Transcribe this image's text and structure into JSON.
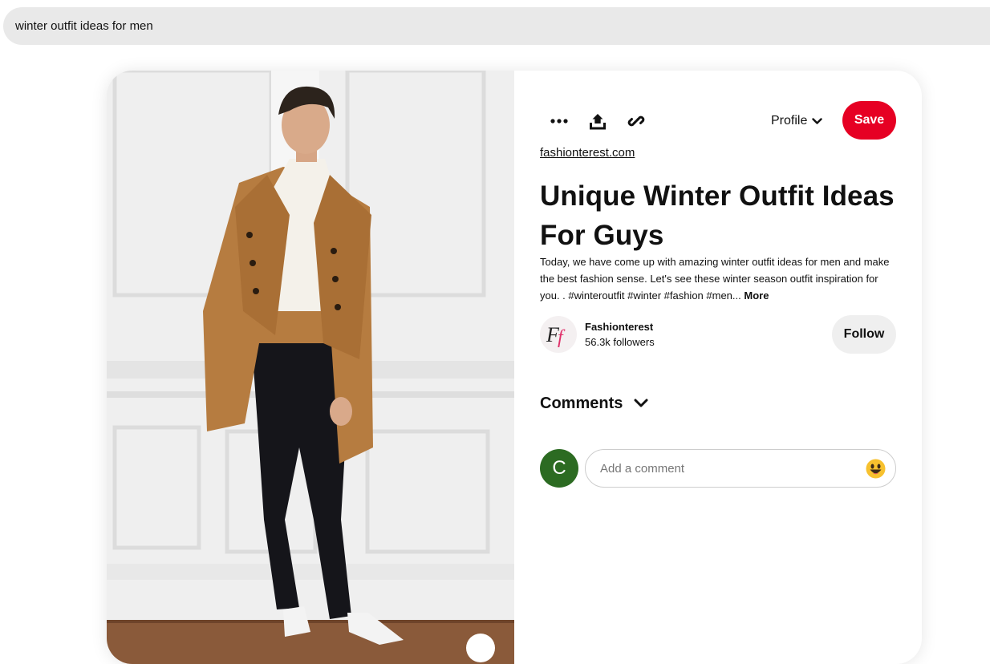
{
  "search": {
    "query": "winter outfit ideas for men"
  },
  "pin": {
    "toolbar": {
      "more_icon": "ellipsis-icon",
      "share_icon": "share-upload-icon",
      "link_icon": "link-icon",
      "profile_label": "Profile",
      "save_label": "Save"
    },
    "source": "fashionterest.com",
    "title": "Unique Winter Outfit Ideas For Guys",
    "description": "Today, we have come up with amazing winter outfit ideas for men and make the best fashion sense. Let's see these winter season outfit inspiration for you. . #winteroutfit #winter #fashion #men...",
    "more_label": "More",
    "creator": {
      "name": "Fashionterest",
      "followers": "56.3k followers",
      "avatar_text": "Ff",
      "follow_label": "Follow"
    },
    "comments": {
      "title": "Comments",
      "user_initial": "C",
      "placeholder": "Add a comment"
    }
  },
  "colors": {
    "save": "#e60023",
    "user_avatar": "#2c6b22",
    "search_bg": "#e9e9e9"
  }
}
